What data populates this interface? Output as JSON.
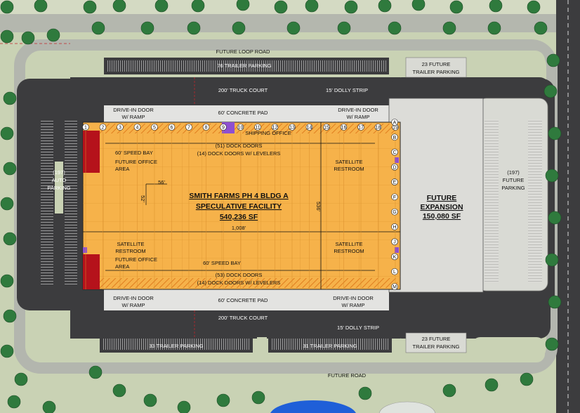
{
  "roads": {
    "future_loop_road": "FUTURE LOOP ROAD",
    "future_road": "FUTURE ROAD",
    "truck_court_top": "200' TRUCK COURT",
    "truck_court_bottom": "200' TRUCK COURT",
    "dolly_strip_top": "15' DOLLY STRIP",
    "dolly_strip_bottom": "15' DOLLY STRIP"
  },
  "parking": {
    "trailer_top": "76 TRAILER PARKING",
    "future_trailer_top": [
      "23 FUTURE",
      "TRAILER PARKING"
    ],
    "trailer_bottom_left": "33 TRAILER PARKING",
    "trailer_bottom_right": "31 TRAILER PARKING",
    "future_trailer_bottom": [
      "23 FUTURE",
      "TRAILER PARKING"
    ],
    "auto_left": [
      "(197)",
      "AUTO",
      "PARKING"
    ],
    "auto_right": [
      "(197)",
      "FUTURE",
      "PARKING"
    ]
  },
  "pads": {
    "concrete_top": "60' CONCRETE PAD",
    "concrete_bottom": "60' CONCRETE PAD",
    "drive_in_top_left": [
      "DRIVE-IN DOOR",
      "W/ RAMP"
    ],
    "drive_in_top_right": [
      "DRIVE-IN DOOR",
      "W/ RAMP"
    ],
    "drive_in_bottom_left": [
      "DRIVE-IN DOOR",
      "W/ RAMP"
    ],
    "drive_in_bottom_right": [
      "DRIVE-IN DOOR",
      "W/ RAMP"
    ]
  },
  "building": {
    "title": [
      "SMITH FARMS PH 4 BLDG A",
      "SPECULATIVE FACILITY",
      "540,236 SF"
    ],
    "shipping_office": "SHIPPING OFFICE",
    "speed_bay_top": "60' SPEED BAY",
    "speed_bay_bottom": "60' SPEED BAY",
    "dock_doors_top": "(51) DOCK DOORS",
    "dock_doors_bottom": "(53) DOCK DOORS",
    "levelers_top": "(14) DOCK DOORS W/ LEVELERS",
    "levelers_bottom": "(14) DOCK DOORS W/ LEVELERS",
    "future_office_top": [
      "FUTURE OFFICE",
      "AREA"
    ],
    "future_office_bottom": [
      "FUTURE OFFICE",
      "AREA"
    ],
    "satellite_restroom_tr": [
      "SATELLITE",
      "RESTROOM"
    ],
    "satellite_restroom_l": [
      "SATELLITE",
      "RESTROOM"
    ],
    "satellite_restroom_r": [
      "SATELLITE",
      "RESTROOM"
    ],
    "dim_bay_width": "56'",
    "dim_bay_depth": "52'",
    "dim_length": "1,008'",
    "dim_depth": "536'",
    "column_lines": [
      "1",
      "2",
      "3",
      "4",
      "5",
      "6",
      "7",
      "8",
      "9",
      "10",
      "11",
      "12",
      "13",
      "14",
      "15",
      "16",
      "17",
      "18",
      "19"
    ],
    "row_lines": [
      "A",
      "B",
      "C",
      "D",
      "E",
      "F",
      "G",
      "H",
      "J",
      "K",
      "L",
      "M"
    ]
  },
  "expansion": {
    "title": [
      "FUTURE",
      "EXPANSION",
      "150,080 SF"
    ]
  },
  "colors": {
    "grass": "#c9d2b4",
    "asphalt": "#3c3c3e",
    "concrete": "#e3e3e1",
    "building": "#f6b24a",
    "office": "#b5121b",
    "tree": "#2f7a3d",
    "water": "#1f5fd8",
    "accent": "#8e4fd1"
  }
}
